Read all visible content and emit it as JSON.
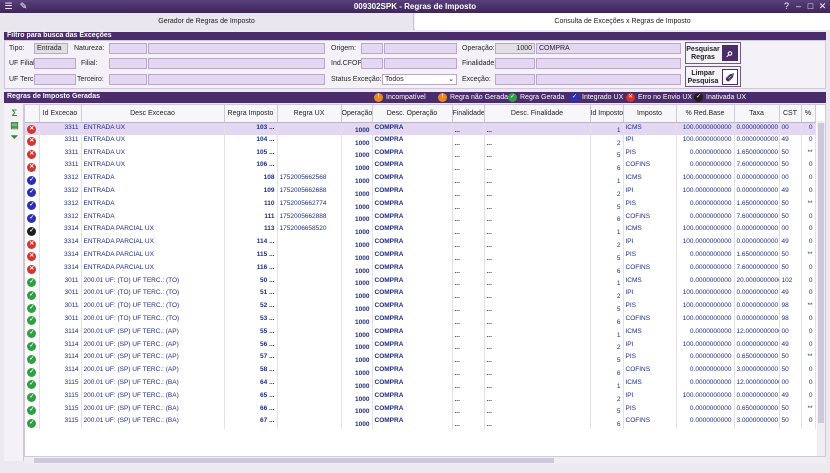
{
  "window": {
    "title": "009302SPK - Regras de Imposto"
  },
  "tabs": [
    "Gerador de Regras de Imposto",
    "Consulta de Exceções x Regras de Imposto"
  ],
  "filter": {
    "section_title": "Filtro para busca das Exceções",
    "tipo_label": "Tipo:",
    "tipo_value": "Entrada",
    "natureza_label": "Natureza:",
    "origem_label": "Origem:",
    "operacao_label": "Operação:",
    "operacao_code": "1000",
    "operacao_desc": "COMPRA",
    "uf_filial_label": "UF Filial:",
    "filial_label": "Filial:",
    "ind_cfop_label": "Ind.CFOP:",
    "finalidade_label": "Finalidade:",
    "uf_terc_label": "UF Terc.:",
    "terceiro_label": "Terceiro:",
    "status_excecao_label": "Status Exceção:",
    "status_excecao_value": "Todos",
    "excecao_label": "Exceção:",
    "pesquisar_l1": "Pesquisar",
    "pesquisar_l2": "Regras",
    "limpar_l1": "Limpar",
    "limpar_l2": "Pesquisa"
  },
  "grid": {
    "title": "Regras de Imposto Geradas",
    "legend": [
      {
        "label": "Incompatível",
        "color": "#e6891e"
      },
      {
        "label": "Regra não Gerada",
        "color": "#e6891e"
      },
      {
        "label": "Regra Gerada",
        "color": "#2ea043"
      },
      {
        "label": "Integrado UX",
        "color": "#2a2fb5"
      },
      {
        "label": "Erro no Envio UX",
        "color": "#d7322d"
      },
      {
        "label": "Inativada UX",
        "color": "#1e1e1e"
      }
    ],
    "columns": [
      "",
      "Id Excecao",
      "Desc Excecao",
      "Regra Imposto",
      "Regra UX",
      "Operação",
      "Desc. Operação",
      "Finalidade",
      "Desc. Finalidade",
      "Id Imposto",
      "Imposto",
      "% Red.Base",
      "Taxa",
      "CST",
      "%"
    ],
    "rows": [
      {
        "status": "erro",
        "id": "3311",
        "desc": "ENTRADA UX",
        "regra": "103 ...",
        "ux": "",
        "op": "1000",
        "dop": "COMPRA",
        "fin": "...",
        "dfin": "...",
        "idimp": "1",
        "imp": "ICMS",
        "red": "100.0000000000",
        "taxa": "0.0000000000",
        "cst": "00",
        "pct": "0"
      },
      {
        "status": "erro",
        "id": "3311",
        "desc": "ENTRADA UX",
        "regra": "104 ...",
        "ux": "",
        "op": "1000",
        "dop": "COMPRA",
        "fin": "...",
        "dfin": "...",
        "idimp": "2",
        "imp": "IPI",
        "red": "100.0000000000",
        "taxa": "0.0000000000",
        "cst": "49",
        "pct": "0"
      },
      {
        "status": "erro",
        "id": "3311",
        "desc": "ENTRADA UX",
        "regra": "105 ...",
        "ux": "",
        "op": "1000",
        "dop": "COMPRA",
        "fin": "...",
        "dfin": "...",
        "idimp": "5",
        "imp": "PIS",
        "red": "0.0000000000",
        "taxa": "1.6500000000",
        "cst": "50",
        "pct": "**"
      },
      {
        "status": "erro",
        "id": "3311",
        "desc": "ENTRADA UX",
        "regra": "106 ...",
        "ux": "",
        "op": "1000",
        "dop": "COMPRA",
        "fin": "...",
        "dfin": "...",
        "idimp": "6",
        "imp": "COFINS",
        "red": "0.0000000000",
        "taxa": "7.6000000000",
        "cst": "50",
        "pct": "0"
      },
      {
        "status": "integrado",
        "id": "3312",
        "desc": "ENTRADA",
        "regra": "108",
        "ux": "1752005662568",
        "op": "1000",
        "dop": "COMPRA",
        "fin": "...",
        "dfin": "...",
        "idimp": "1",
        "imp": "ICMS",
        "red": "100.0000000000",
        "taxa": "0.0000000000",
        "cst": "00",
        "pct": "0"
      },
      {
        "status": "integrado",
        "id": "3312",
        "desc": "ENTRADA",
        "regra": "109",
        "ux": "1752005662688",
        "op": "1000",
        "dop": "COMPRA",
        "fin": "...",
        "dfin": "...",
        "idimp": "2",
        "imp": "IPI",
        "red": "100.0000000000",
        "taxa": "0.0000000000",
        "cst": "49",
        "pct": "0"
      },
      {
        "status": "integrado",
        "id": "3312",
        "desc": "ENTRADA",
        "regra": "110",
        "ux": "1752005662774",
        "op": "1000",
        "dop": "COMPRA",
        "fin": "...",
        "dfin": "...",
        "idimp": "5",
        "imp": "PIS",
        "red": "0.0000000000",
        "taxa": "1.6500000000",
        "cst": "50",
        "pct": "**"
      },
      {
        "status": "integrado",
        "id": "3312",
        "desc": "ENTRADA",
        "regra": "111",
        "ux": "1752005662888",
        "op": "1000",
        "dop": "COMPRA",
        "fin": "...",
        "dfin": "...",
        "idimp": "6",
        "imp": "COFINS",
        "red": "0.0000000000",
        "taxa": "7.6000000000",
        "cst": "50",
        "pct": "0"
      },
      {
        "status": "inativada",
        "id": "3314",
        "desc": "ENTRADA PARCIAL UX",
        "regra": "113",
        "ux": "1752006658520",
        "op": "1000",
        "dop": "COMPRA",
        "fin": "...",
        "dfin": "...",
        "idimp": "1",
        "imp": "ICMS",
        "red": "100.0000000000",
        "taxa": "0.0000000000",
        "cst": "00",
        "pct": "0"
      },
      {
        "status": "erro",
        "id": "3314",
        "desc": "ENTRADA PARCIAL UX",
        "regra": "114 ...",
        "ux": "",
        "op": "1000",
        "dop": "COMPRA",
        "fin": "...",
        "dfin": "...",
        "idimp": "2",
        "imp": "IPI",
        "red": "100.0000000000",
        "taxa": "0.0000000000",
        "cst": "49",
        "pct": "0"
      },
      {
        "status": "erro",
        "id": "3314",
        "desc": "ENTRADA PARCIAL UX",
        "regra": "115 ...",
        "ux": "",
        "op": "1000",
        "dop": "COMPRA",
        "fin": "...",
        "dfin": "...",
        "idimp": "5",
        "imp": "PIS",
        "red": "0.0000000000",
        "taxa": "1.6500000000",
        "cst": "50",
        "pct": "**"
      },
      {
        "status": "erro",
        "id": "3314",
        "desc": "ENTRADA PARCIAL UX",
        "regra": "116 ...",
        "ux": "",
        "op": "1000",
        "dop": "COMPRA",
        "fin": "...",
        "dfin": "...",
        "idimp": "6",
        "imp": "COFINS",
        "red": "0.0000000000",
        "taxa": "7.6000000000",
        "cst": "50",
        "pct": "0"
      },
      {
        "status": "gerada",
        "id": "3011",
        "desc": "200.01 UF: (TO) UF TERC.: (TO)",
        "regra": "50 ...",
        "ux": "",
        "op": "1000",
        "dop": "COMPRA",
        "fin": "...",
        "dfin": "...",
        "idimp": "1",
        "imp": "ICMS",
        "red": "0.0000000000",
        "taxa": "20.0000000000",
        "cst": "102",
        "pct": "0"
      },
      {
        "status": "gerada",
        "id": "3011",
        "desc": "200.01 UF: (TO) UF TERC.: (TO)",
        "regra": "51 ...",
        "ux": "",
        "op": "1000",
        "dop": "COMPRA",
        "fin": "...",
        "dfin": "...",
        "idimp": "2",
        "imp": "IPI",
        "red": "100.0000000000",
        "taxa": "0.0000000000",
        "cst": "49",
        "pct": "0"
      },
      {
        "status": "gerada",
        "id": "3011",
        "desc": "200.01 UF: (TO) UF TERC.: (TO)",
        "regra": "52 ...",
        "ux": "",
        "op": "1000",
        "dop": "COMPRA",
        "fin": "...",
        "dfin": "...",
        "idimp": "5",
        "imp": "PIS",
        "red": "100.0000000000",
        "taxa": "0.0000000000",
        "cst": "98",
        "pct": "**"
      },
      {
        "status": "gerada",
        "id": "3011",
        "desc": "200.01 UF: (TO) UF TERC.: (TO)",
        "regra": "53 ...",
        "ux": "",
        "op": "1000",
        "dop": "COMPRA",
        "fin": "...",
        "dfin": "...",
        "idimp": "6",
        "imp": "COFINS",
        "red": "100.0000000000",
        "taxa": "0.0000000000",
        "cst": "98",
        "pct": "0"
      },
      {
        "status": "gerada",
        "id": "3114",
        "desc": "200.01 UF: (SP) UF TERC.: (AP)",
        "regra": "55 ...",
        "ux": "",
        "op": "1000",
        "dop": "COMPRA",
        "fin": "...",
        "dfin": "...",
        "idimp": "1",
        "imp": "ICMS",
        "red": "0.0000000000",
        "taxa": "12.0000000000",
        "cst": "00",
        "pct": "0"
      },
      {
        "status": "gerada",
        "id": "3114",
        "desc": "200.01 UF: (SP) UF TERC.: (AP)",
        "regra": "56 ...",
        "ux": "",
        "op": "1000",
        "dop": "COMPRA",
        "fin": "...",
        "dfin": "...",
        "idimp": "2",
        "imp": "IPI",
        "red": "100.0000000000",
        "taxa": "0.0000000000",
        "cst": "49",
        "pct": "0"
      },
      {
        "status": "gerada",
        "id": "3114",
        "desc": "200.01 UF: (SP) UF TERC.: (AP)",
        "regra": "57 ...",
        "ux": "",
        "op": "1000",
        "dop": "COMPRA",
        "fin": "...",
        "dfin": "...",
        "idimp": "5",
        "imp": "PIS",
        "red": "0.0000000000",
        "taxa": "0.6500000000",
        "cst": "50",
        "pct": "**"
      },
      {
        "status": "gerada",
        "id": "3114",
        "desc": "200.01 UF: (SP) UF TERC.: (AP)",
        "regra": "58 ...",
        "ux": "",
        "op": "1000",
        "dop": "COMPRA",
        "fin": "...",
        "dfin": "...",
        "idimp": "6",
        "imp": "COFINS",
        "red": "0.0000000000",
        "taxa": "3.0000000000",
        "cst": "50",
        "pct": "0"
      },
      {
        "status": "gerada",
        "id": "3115",
        "desc": "200.01 UF: (SP) UF TERC.: (BA)",
        "regra": "64 ...",
        "ux": "",
        "op": "1000",
        "dop": "COMPRA",
        "fin": "...",
        "dfin": "...",
        "idimp": "1",
        "imp": "ICMS",
        "red": "0.0000000000",
        "taxa": "12.0000000000",
        "cst": "00",
        "pct": "0"
      },
      {
        "status": "gerada",
        "id": "3115",
        "desc": "200.01 UF: (SP) UF TERC.: (BA)",
        "regra": "65 ...",
        "ux": "",
        "op": "1000",
        "dop": "COMPRA",
        "fin": "...",
        "dfin": "...",
        "idimp": "2",
        "imp": "IPI",
        "red": "100.0000000000",
        "taxa": "0.0000000000",
        "cst": "49",
        "pct": "0"
      },
      {
        "status": "gerada",
        "id": "3115",
        "desc": "200.01 UF: (SP) UF TERC.: (BA)",
        "regra": "66 ...",
        "ux": "",
        "op": "1000",
        "dop": "COMPRA",
        "fin": "...",
        "dfin": "...",
        "idimp": "5",
        "imp": "PIS",
        "red": "0.0000000000",
        "taxa": "0.6500000000",
        "cst": "50",
        "pct": "**"
      },
      {
        "status": "gerada",
        "id": "3115",
        "desc": "200.01 UF: (SP) UF TERC.: (BA)",
        "regra": "67 ...",
        "ux": "",
        "op": "1000",
        "dop": "COMPRA",
        "fin": "...",
        "dfin": "...",
        "idimp": "6",
        "imp": "COFINS",
        "red": "0.0000000000",
        "taxa": "3.0000000000",
        "cst": "50",
        "pct": "0"
      }
    ]
  }
}
